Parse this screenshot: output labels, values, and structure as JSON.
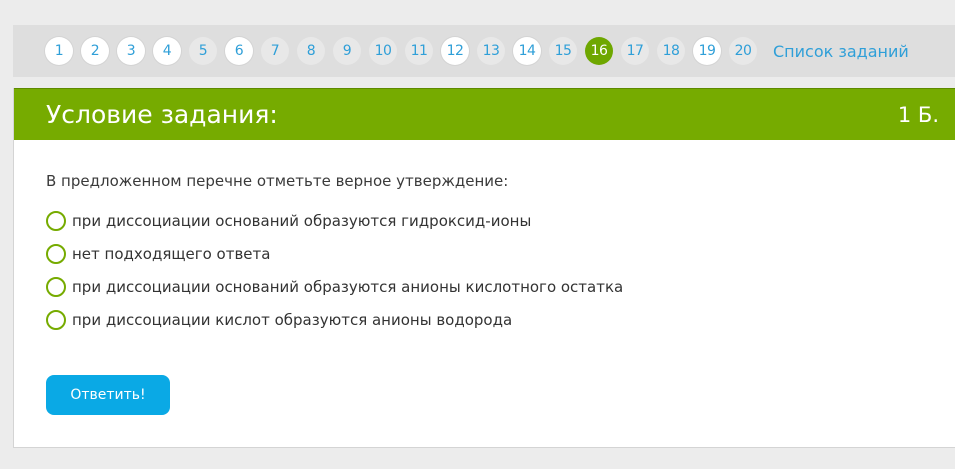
{
  "nav": {
    "pages": [
      "1",
      "2",
      "3",
      "4",
      "5",
      "6",
      "7",
      "8",
      "9",
      "10",
      "11",
      "12",
      "13",
      "14",
      "15",
      "16",
      "17",
      "18",
      "19",
      "20"
    ],
    "active_page": "16",
    "task_list_label": "Список заданий"
  },
  "task": {
    "title": "Условие задания:",
    "score": "1 Б.",
    "question": "В предложенном перечне отметьте верное утверждение:",
    "options": [
      "при диссоциации оснований образуются гидроксид-ионы",
      "нет подходящего ответа",
      "при диссоциации оснований образуются анионы кислотного остатка",
      "при диссоциации кислот образуются анионы водорода"
    ],
    "submit_label": "Ответить!"
  },
  "colors": {
    "accent_green": "#76ab00",
    "link_blue": "#2f9fd8",
    "button_blue": "#0aa9e5"
  }
}
